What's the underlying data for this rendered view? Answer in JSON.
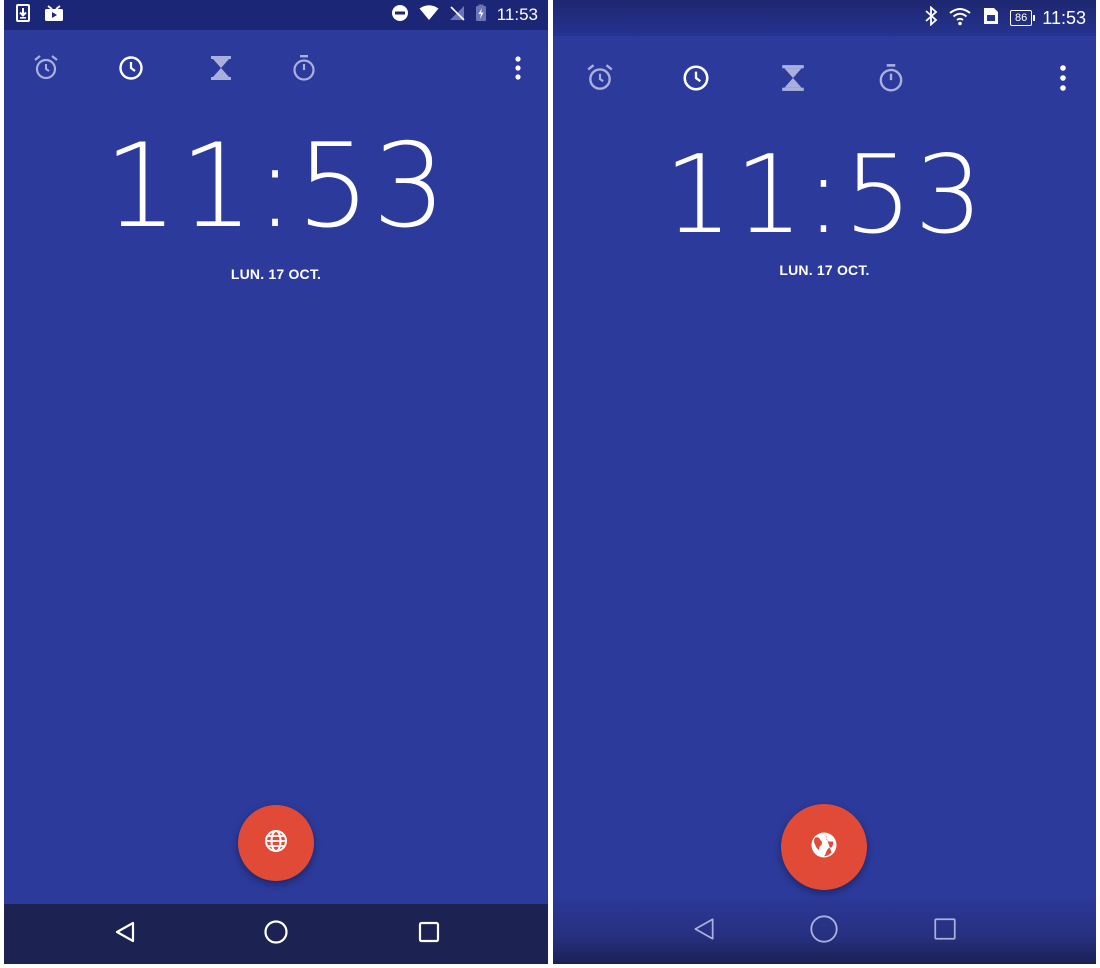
{
  "colors": {
    "background": "#2c3a9b",
    "statusbar_left": "#1c2676",
    "navbar_left": "#1c2353",
    "fab": "#e04a37",
    "text": "#ffffff"
  },
  "left_phone": {
    "statusbar": {
      "time": "11:53",
      "left_icons": [
        "download-icon",
        "media-icon"
      ],
      "right_icons": [
        "do-not-disturb-icon",
        "wifi-icon",
        "no-sim-icon",
        "battery-charging-icon"
      ]
    },
    "tabs": [
      {
        "name": "alarm",
        "icon": "alarm-icon"
      },
      {
        "name": "clock",
        "icon": "clock-icon",
        "selected": true
      },
      {
        "name": "timer",
        "icon": "hourglass-icon"
      },
      {
        "name": "stopwatch",
        "icon": "stopwatch-icon"
      }
    ],
    "overflow_icon": "more-vert-icon",
    "clock": {
      "time": "11:53",
      "date": "LUN. 17 OCT."
    },
    "fab_icon": "globe-icon",
    "navbar": [
      "back-icon",
      "home-icon",
      "recents-icon"
    ]
  },
  "right_phone": {
    "statusbar": {
      "time": "11:53",
      "battery_level": "86",
      "right_icons": [
        "bluetooth-icon",
        "wifi-icon",
        "sim-icon",
        "battery-icon"
      ]
    },
    "tabs": [
      {
        "name": "alarm",
        "icon": "alarm-icon"
      },
      {
        "name": "clock",
        "icon": "clock-icon",
        "selected": true
      },
      {
        "name": "timer",
        "icon": "hourglass-icon"
      },
      {
        "name": "stopwatch",
        "icon": "stopwatch-icon"
      }
    ],
    "overflow_icon": "more-vert-icon",
    "clock": {
      "time": "11:53",
      "date": "LUN. 17 OCT."
    },
    "fab_icon": "earth-icon",
    "navbar": [
      "back-icon",
      "home-icon",
      "recents-icon"
    ]
  }
}
